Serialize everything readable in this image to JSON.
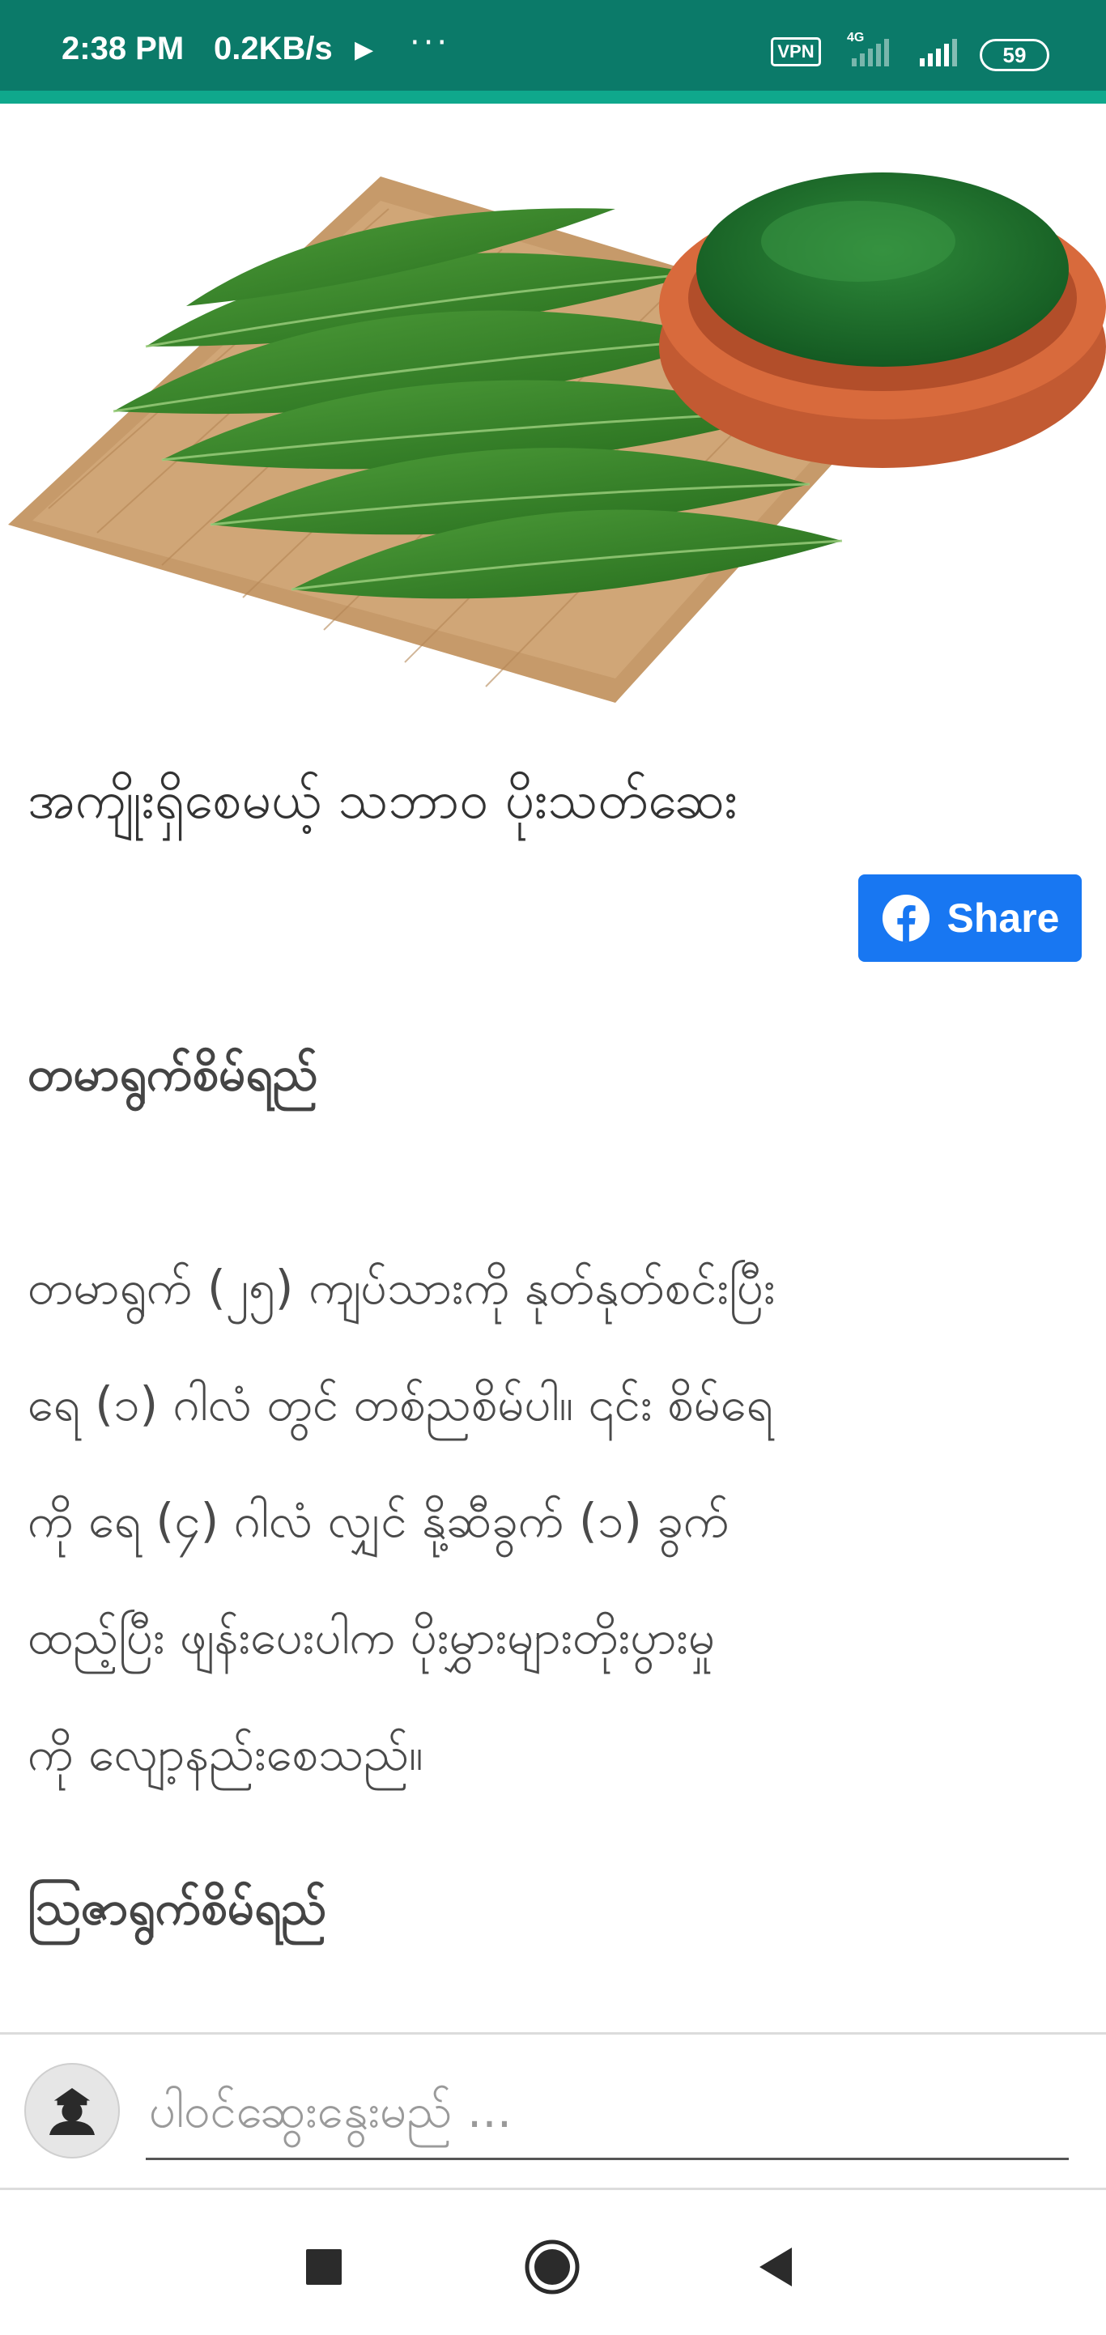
{
  "status_bar": {
    "time": "2:38 PM",
    "speed": "0.2KB/s",
    "dots": "···",
    "vpn": "VPN",
    "network": "4G",
    "battery": "59"
  },
  "article": {
    "title": "အကျိုးရှိစေမယ့် သဘာဝ ပိုးသတ်ဆေး",
    "share_label": "Share",
    "section1_heading": "တမာရွက်စိမ်ရည်",
    "paragraph_lines": [
      "တမာရွက် (၂၅) ကျပ်သားကို နုတ်နုတ်စင်းပြီး",
      "ရေ (၁) ဂါလံ တွင် တစ်ညစိမ်ပါ။  ၎င်း စိမ်ရေ",
      "ကို ရေ (၄) ဂါလံ လျှင်  နို့ဆီခွက် (၁) ခွက်",
      "ထည့်ပြီး ဖျန်းပေးပါက ပိုးမွှားများတိုးပွားမှု",
      "ကို လျော့နည်းစေသည်။"
    ],
    "section2_heading": "သြဇာရွက်စိမ်ရည်"
  },
  "comment_bar": {
    "placeholder": "ပါဝင်ဆွေးနွေးမည် ..."
  },
  "colors": {
    "status_bar": "#0b7a69",
    "share_button": "#1877f2",
    "nav_icons": "#2b2b2b"
  },
  "icons": {
    "play": "play-icon",
    "vpn": "vpn-badge",
    "signal": "signal-icon",
    "battery": "battery-icon",
    "facebook": "facebook-icon",
    "avatar": "user-avatar-icon",
    "nav_recent": "square-icon",
    "nav_home": "circle-icon",
    "nav_back": "back-triangle-icon"
  }
}
